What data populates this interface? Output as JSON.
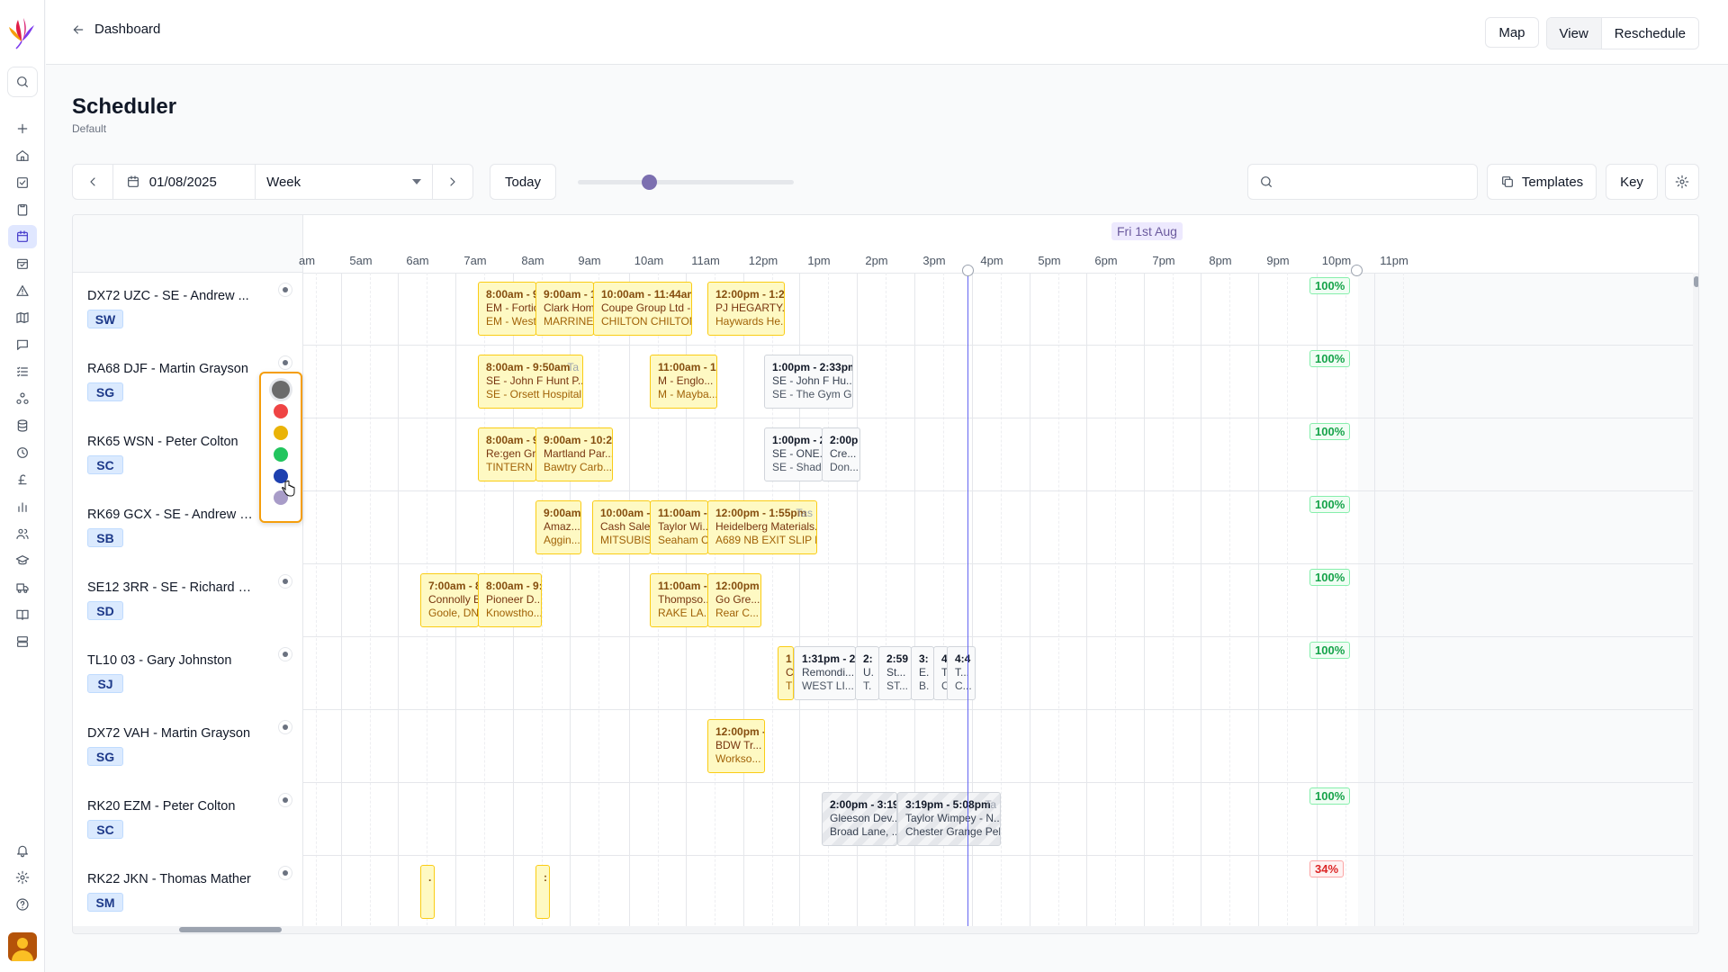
{
  "topbar": {
    "back_label": "Dashboard",
    "actions": {
      "map": "Map",
      "view": "View",
      "reschedule": "Reschedule"
    }
  },
  "page": {
    "title": "Scheduler",
    "subtitle": "Default"
  },
  "toolbar": {
    "date": "01/08/2025",
    "range": "Week",
    "today": "Today",
    "search_placeholder": "",
    "templates": "Templates",
    "key": "Key",
    "zoom_fraction": 0.32
  },
  "timeline": {
    "day_label": "Fri 1st Aug",
    "hours": [
      "am",
      "5am",
      "6am",
      "7am",
      "8am",
      "9am",
      "10am",
      "11am",
      "12pm",
      "1pm",
      "2pm",
      "3pm",
      "4pm",
      "5pm",
      "6pm",
      "7pm",
      "8pm",
      "9pm",
      "10pm",
      "11pm"
    ]
  },
  "rows": [
    {
      "name": "DX72 UZC - SE - Andrew ...",
      "badge": "SW",
      "util": "100%",
      "events": [
        {
          "time": "8:00am - 9:",
          "client": "EM - Forticr",
          "loc": "EM - West A"
        },
        {
          "time": "9:00am - 10",
          "client": "Clark Home",
          "loc": "MARRINERS"
        },
        {
          "time": "10:00am - 11:44am",
          "client": "Coupe Group Ltd -...",
          "loc": "CHILTON CHILTON"
        },
        {
          "time": "12:00pm - 1:21",
          "client": "PJ HEGARTY...",
          "loc": "Haywards He..."
        }
      ]
    },
    {
      "name": "RA68 DJF - Martin Grayson",
      "badge": "SG",
      "util": "100%",
      "events": [
        {
          "time": "8:00am - 9:50am",
          "client": "SE - John F Hunt P...",
          "loc": "SE - Orsett Hospital ...",
          "tag": "Ta"
        },
        {
          "time": "11:00am - 12",
          "client": "M - Englo...",
          "loc": "M - Mayba..."
        },
        {
          "time": "1:00pm - 2:33pm",
          "client": "SE - John F Hu...",
          "loc": "SE - The Gym G..."
        }
      ]
    },
    {
      "name": "RK65 WSN - Peter Colton",
      "badge": "SC",
      "util": "100%",
      "events": [
        {
          "time": "8:00am - 9:",
          "client": "Re:gen Grou",
          "loc": "TINTERN RC"
        },
        {
          "time": "9:00am - 10:21",
          "client": "Martland Par...",
          "loc": "Bawtry Carb..."
        },
        {
          "time": "1:00pm - 2:0",
          "client": "SE - ONE...",
          "loc": "SE - Shad..."
        },
        {
          "time": "2:00p",
          "client": "Cre...",
          "loc": "Don..."
        }
      ]
    },
    {
      "name": "RK69 GCX - SE - Andrew B...",
      "badge": "SB",
      "util": "100%",
      "events": [
        {
          "time": "9:00am",
          "client": "Amaz...",
          "loc": "Aggin..."
        },
        {
          "time": "10:00am - 11",
          "client": "Cash Sale ...",
          "loc": "MITSUBIS..."
        },
        {
          "time": "11:00am - 12",
          "client": "Taylor Wi...",
          "loc": "Seaham C..."
        },
        {
          "time": "12:00pm - 1:55pm",
          "client": "Heidelberg Materials...",
          "loc": "A689 NB EXIT SLIP D...",
          "tag": "Tas"
        }
      ]
    },
    {
      "name": "SE12 3RR - SE - Richard D...",
      "badge": "SD",
      "util": "100%",
      "events": [
        {
          "time": "7:00am - 8:",
          "client": "Connolly Br",
          "loc": "Goole, DN14"
        },
        {
          "time": "8:00am - 9:",
          "client": "Pioneer D...",
          "loc": "Knowstho..."
        },
        {
          "time": "11:00am - 1:",
          "client": "Thompso...",
          "loc": "RAKE LA..."
        },
        {
          "time": "12:00pm",
          "client": "Go Gre...",
          "loc": "Rear C..."
        }
      ]
    },
    {
      "name": "TL10 03 - Gary Johnston",
      "badge": "SJ",
      "util": "100%",
      "events": [
        {
          "time": "1",
          "client": "C",
          "loc": "T"
        },
        {
          "time": "1:31pm - 2:",
          "client": "Remondi...",
          "loc": "WEST LI..."
        },
        {
          "time": "2:",
          "client": "U.",
          "loc": "T."
        },
        {
          "time": "2:59",
          "client": "St...",
          "loc": "ST..."
        },
        {
          "time": "3:",
          "client": "E.",
          "loc": "B."
        },
        {
          "time": "4:11",
          "client": "T...",
          "loc": "C..."
        },
        {
          "time": "4:4",
          "client": "T...",
          "loc": "C..."
        }
      ]
    },
    {
      "name": "DX72 VAH - Martin Grayson",
      "badge": "SG",
      "util": "",
      "events": [
        {
          "time": "12:00pm -",
          "client": "BDW Tr...",
          "loc": "Workso..."
        }
      ]
    },
    {
      "name": "RK20 EZM - Peter Colton",
      "badge": "SC",
      "util": "100%",
      "events": [
        {
          "time": "2:00pm - 3:19",
          "client": "Gleeson Dev...",
          "loc": "Broad Lane, ..."
        },
        {
          "time": "3:19pm - 5:08pm",
          "client": "Taylor Wimpey - N...",
          "loc": "Chester Grange Pel...",
          "tag": "Ta"
        }
      ]
    },
    {
      "name": "RK22 JKN - Thomas Mather",
      "badge": "SM",
      "util": "34%",
      "events": [
        {
          "time": ".",
          "client": "",
          "loc": ""
        },
        {
          "time": ":",
          "client": "",
          "loc": ""
        }
      ]
    }
  ],
  "picker": {
    "colors": [
      "#6b6b6b",
      "#ef4444",
      "#eab308",
      "#22c55e",
      "#1e40af",
      "#a89cc8"
    ]
  }
}
